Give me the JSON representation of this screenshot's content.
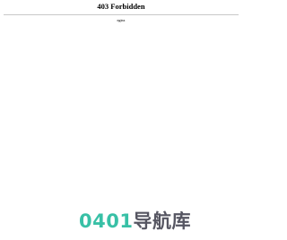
{
  "page": {
    "title": "403 Forbidden",
    "server": "nginx"
  },
  "watermark": {
    "digits": "0401",
    "text": "导航库",
    "digits_color": "#1db89a",
    "text_color": "#3f3f4d"
  }
}
